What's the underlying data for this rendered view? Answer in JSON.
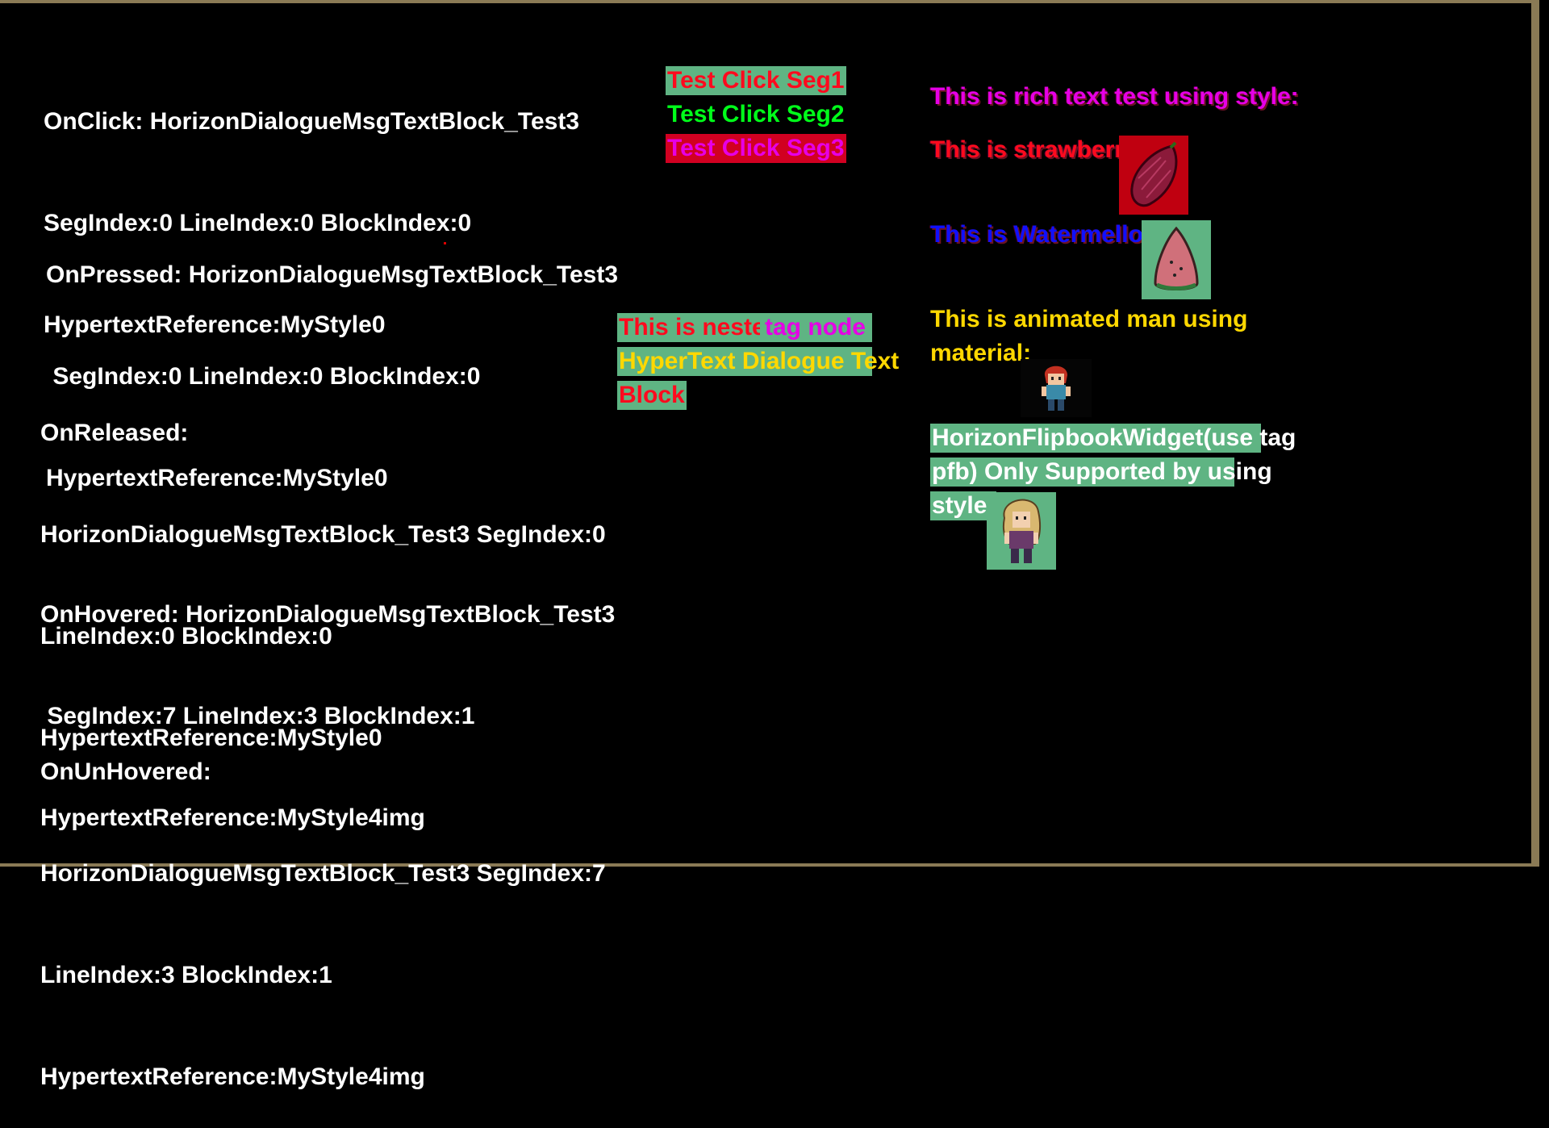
{
  "event_log": {
    "on_click": [
      "OnClick: HorizonDialogueMsgTextBlock_Test3",
      "SegIndex:0 LineIndex:0 BlockIndex:0",
      "HypertextReference:MyStyle0"
    ],
    "on_pressed": [
      "OnPressed: HorizonDialogueMsgTextBlock_Test3",
      " SegIndex:0 LineIndex:0 BlockIndex:0",
      "HypertextReference:MyStyle0"
    ],
    "on_released": [
      "OnReleased:",
      "HorizonDialogueMsgTextBlock_Test3 SegIndex:0",
      "LineIndex:0 BlockIndex:0",
      "HypertextReference:MyStyle0"
    ],
    "on_hovered": [
      "OnHovered: HorizonDialogueMsgTextBlock_Test3",
      " SegIndex:7 LineIndex:3 BlockIndex:1",
      "HypertextReference:MyStyle4img"
    ],
    "on_unhovered": [
      "OnUnHovered:",
      "HorizonDialogueMsgTextBlock_Test3 SegIndex:7",
      "LineIndex:3 BlockIndex:1",
      "HypertextReference:MyStyle4img"
    ]
  },
  "test_click": {
    "seg1": "Test Click Seg1",
    "seg2": "Test Click Seg2",
    "seg3": "Test Click Seg3"
  },
  "nested": {
    "part1": "This is nested",
    "part2": " tag node",
    "line2": "HyperText Dialogue Text",
    "line3": "Block"
  },
  "rich_text": {
    "style_line": "This is rich text test using style:",
    "strawberry": "This is strawberry:",
    "watermelon": "This is Watermellon:",
    "animated_line1": "This is animated man using",
    "animated_line2": "material:",
    "flipbook_line1": "HorizonFlipbookWidget(use tag",
    "flipbook_line2": "pfb) Only Supported by using",
    "flipbook_line3": "style:"
  },
  "colors": {
    "highlight_green": "#5fb483",
    "highlight_red": "#d10021",
    "text_red": "#ff0a1e",
    "text_green": "#00ff1a",
    "text_magenta": "#e600e6",
    "text_blue": "#1010ff",
    "text_yellow": "#ffd800",
    "frame": "#8a7a55"
  },
  "icons": {
    "strawberry": "strawberry-icon",
    "watermelon": "watermelon-slice-icon",
    "animated_man": "pixel-man-sprite-icon",
    "flipbook": "pixel-girl-sprite-icon"
  }
}
